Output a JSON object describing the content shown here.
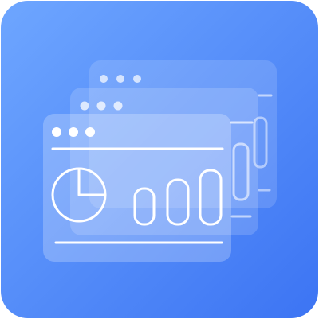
{
  "icon": {
    "name": "dashboard-windows-icon",
    "background_gradient": [
      "#6aa2ff",
      "#3f78f4"
    ],
    "stroke_color": "#ffffff",
    "window_fill": "#ffffff"
  }
}
